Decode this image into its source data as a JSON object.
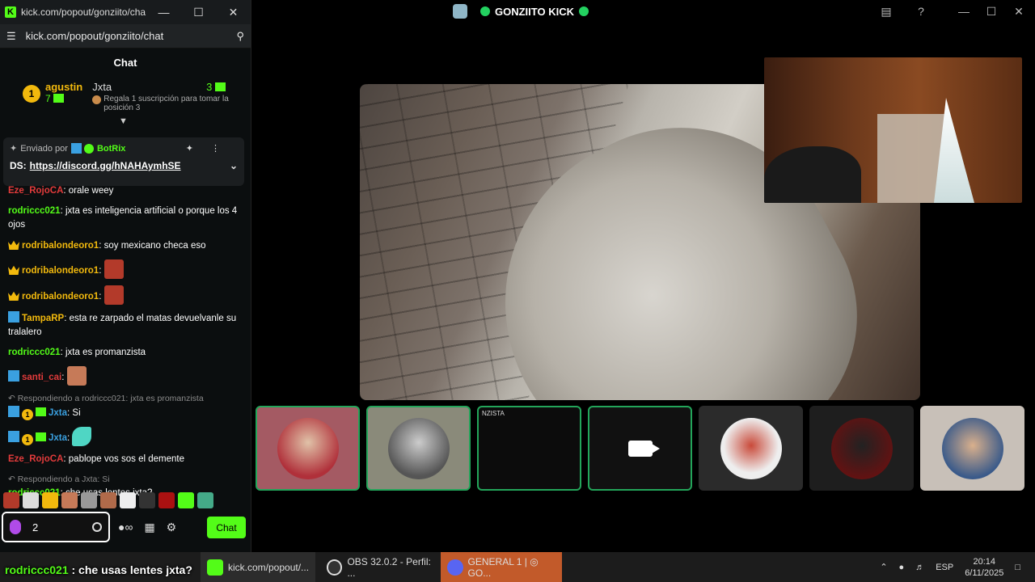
{
  "chat_window": {
    "title": "kick.com/popout/gonziito/cha...",
    "url": "kick.com/popout/gonziito/chat",
    "header": "Chat",
    "leaderboard": {
      "rank": "1",
      "name": "agustin",
      "count": "7",
      "jxta_name": "Jxta",
      "jxta_count": "3",
      "promo": "Regala 1 suscripción para tomar la posición 3"
    },
    "pinned": {
      "sent_by": "Enviado por",
      "bot_name": "BotRix",
      "prefix": "DS:",
      "link": "https://discord.gg/hNAHAymhSE"
    },
    "messages": [
      {
        "user": "Eze_RojoCA",
        "sep": ":",
        "text": " orale weey"
      },
      {
        "user": "rodriccc021",
        "sep": ":",
        "text": " jxta es inteligencia artificial o porque los 4 ojos"
      },
      {
        "user": "rodribalondeoro1",
        "sep": ":",
        "text": " soy mexicano checa eso"
      },
      {
        "user": "rodribalondeoro1",
        "sep": ":",
        "text": ""
      },
      {
        "user": "rodribalondeoro1",
        "sep": ":",
        "text": ""
      },
      {
        "user": "TampaRP",
        "sep": ":",
        "text": " esta re zarpado el matas devuelvanle su tralalero"
      },
      {
        "user": "rodriccc021",
        "sep": ":",
        "text": " jxta es promanzista"
      },
      {
        "user": "santi_cai",
        "sep": ":",
        "text": ""
      },
      {
        "reply": "Respondiendo a rodriccc021: jxta es promanzista",
        "user": "Jxta",
        "sep": ":",
        "text": " Si"
      },
      {
        "user": "Jxta",
        "sep": ":",
        "text": ""
      },
      {
        "user": "Eze_RojoCA",
        "sep": ":",
        "text": " pablope vos sos el demente"
      },
      {
        "reply": "Respondiendo a Jxta: Si",
        "user": "rodriccc021",
        "sep": ":",
        "text": " che usas lentes jxta?"
      }
    ],
    "input_value": "2",
    "chat_button": "Chat"
  },
  "call_window": {
    "title": "GONZIITO KICK",
    "tile_label": "NZISTA"
  },
  "taskbar": {
    "overlay_user": "rodriccc021",
    "overlay_text": " : che usas lentes jxta?",
    "apps": [
      {
        "label": "kick.com/popout/..."
      },
      {
        "label": "OBS 32.0.2 - Perfil: ..."
      },
      {
        "label": "GENERAL 1 | ◎ GO..."
      }
    ],
    "lang": "ESP",
    "time": "20:14",
    "date": "6/11/2025"
  },
  "colors": {
    "kick_green": "#53fc18",
    "gold": "#f2b90d",
    "username_red": "#e23b3b",
    "mod_blue": "#3aa0e0",
    "speaking_green": "#23a55a"
  }
}
